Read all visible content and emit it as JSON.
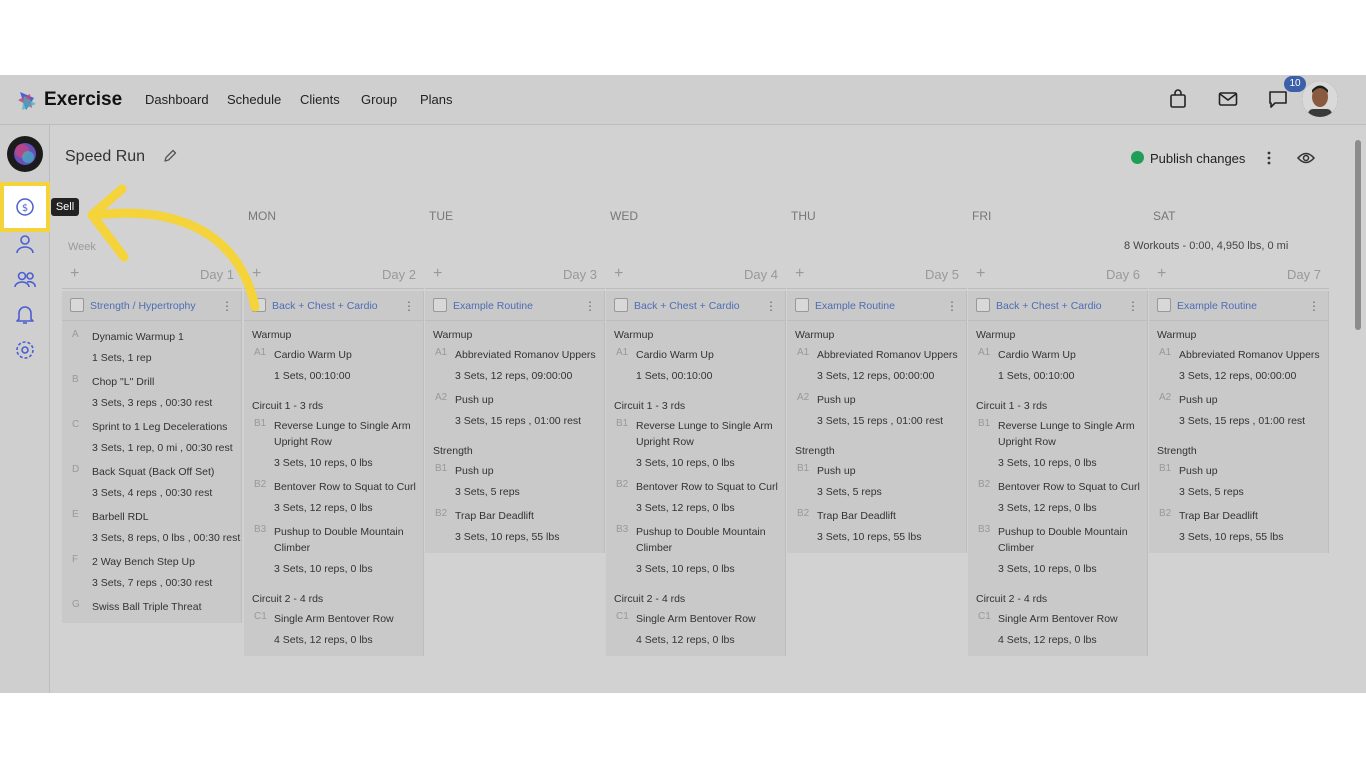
{
  "app": {
    "name": "Exercise"
  },
  "nav": {
    "items": [
      "Dashboard",
      "Schedule",
      "Clients",
      "Group",
      "Plans"
    ]
  },
  "top_icons": {
    "badge_count": "10"
  },
  "rail": {
    "tooltip": "Sell"
  },
  "plan": {
    "title": "Speed Run",
    "publish_label": "Publish changes"
  },
  "days": [
    "MON",
    "TUE",
    "WED",
    "THU",
    "FRI",
    "SAT"
  ],
  "summary": "8 Workouts - 0:00, 4,950 lbs, 0 mi",
  "week_label": "Week",
  "columns": [
    {
      "day": "Day 1",
      "workout": "Strength / Hypertrophy",
      "blocks": [
        {
          "section": "",
          "exercises": [
            {
              "code": "A",
              "name": "Dynamic Warmup 1",
              "detail": "1 Sets, 1 rep"
            },
            {
              "code": "B",
              "name": "Chop \"L\" Drill",
              "detail": "3 Sets, 3 reps , 00:30 rest"
            },
            {
              "code": "C",
              "name": "Sprint to 1 Leg Decelerations",
              "detail": "3 Sets, 1 rep, 0 mi , 00:30 rest"
            },
            {
              "code": "D",
              "name": "Back Squat (Back Off Set)",
              "detail": "3 Sets, 4 reps , 00:30 rest"
            },
            {
              "code": "E",
              "name": "Barbell RDL",
              "detail": "3 Sets, 8 reps, 0 lbs , 00:30 rest"
            },
            {
              "code": "F",
              "name": "2 Way Bench Step Up",
              "detail": "3 Sets, 7 reps , 00:30 rest"
            },
            {
              "code": "G",
              "name": "Swiss Ball Triple Threat",
              "detail": ""
            }
          ]
        }
      ]
    },
    {
      "day": "Day 2",
      "workout": "Back + Chest + Cardio",
      "blocks": [
        {
          "section": "Warmup",
          "exercises": [
            {
              "code": "A1",
              "name": "Cardio Warm Up",
              "detail": "1 Sets, 00:10:00"
            }
          ]
        },
        {
          "section": "Circuit 1 - 3 rds",
          "exercises": [
            {
              "code": "B1",
              "name": "Reverse Lunge to Single Arm Upright Row",
              "detail": "3 Sets, 10 reps, 0 lbs"
            },
            {
              "code": "B2",
              "name": "Bentover Row to Squat to Curl",
              "detail": "3 Sets, 12 reps, 0 lbs"
            },
            {
              "code": "B3",
              "name": "Pushup to Double Mountain Climber",
              "detail": "3 Sets, 10 reps, 0 lbs"
            }
          ]
        },
        {
          "section": "Circuit 2 - 4 rds",
          "exercises": [
            {
              "code": "C1",
              "name": "Single Arm Bentover Row",
              "detail": "4 Sets, 12 reps, 0 lbs"
            }
          ]
        }
      ]
    },
    {
      "day": "Day 3",
      "workout": "Example Routine",
      "blocks": [
        {
          "section": "Warmup",
          "exercises": [
            {
              "code": "A1",
              "name": "Abbreviated Romanov Uppers",
              "detail": "3 Sets, 12 reps, 09:00:00"
            },
            {
              "code": "A2",
              "name": "Push up",
              "detail": "3 Sets, 15 reps , 01:00 rest"
            }
          ]
        },
        {
          "section": "Strength",
          "exercises": [
            {
              "code": "B1",
              "name": "Push up",
              "detail": "3 Sets, 5 reps"
            },
            {
              "code": "B2",
              "name": "Trap Bar Deadlift",
              "detail": "3 Sets, 10 reps, 55 lbs"
            }
          ]
        }
      ]
    },
    {
      "day": "Day 4",
      "workout": "Back + Chest + Cardio",
      "blocks": [
        {
          "section": "Warmup",
          "exercises": [
            {
              "code": "A1",
              "name": "Cardio Warm Up",
              "detail": "1 Sets, 00:10:00"
            }
          ]
        },
        {
          "section": "Circuit 1 - 3 rds",
          "exercises": [
            {
              "code": "B1",
              "name": "Reverse Lunge to Single Arm Upright Row",
              "detail": "3 Sets, 10 reps, 0 lbs"
            },
            {
              "code": "B2",
              "name": "Bentover Row to Squat to Curl",
              "detail": "3 Sets, 12 reps, 0 lbs"
            },
            {
              "code": "B3",
              "name": "Pushup to Double Mountain Climber",
              "detail": "3 Sets, 10 reps, 0 lbs"
            }
          ]
        },
        {
          "section": "Circuit 2 - 4 rds",
          "exercises": [
            {
              "code": "C1",
              "name": "Single Arm Bentover Row",
              "detail": "4 Sets, 12 reps, 0 lbs"
            }
          ]
        }
      ]
    },
    {
      "day": "Day 5",
      "workout": "Example Routine",
      "blocks": [
        {
          "section": "Warmup",
          "exercises": [
            {
              "code": "A1",
              "name": "Abbreviated Romanov Uppers",
              "detail": "3 Sets, 12 reps, 00:00:00"
            },
            {
              "code": "A2",
              "name": "Push up",
              "detail": "3 Sets, 15 reps , 01:00 rest"
            }
          ]
        },
        {
          "section": "Strength",
          "exercises": [
            {
              "code": "B1",
              "name": "Push up",
              "detail": "3 Sets, 5 reps"
            },
            {
              "code": "B2",
              "name": "Trap Bar Deadlift",
              "detail": "3 Sets, 10 reps, 55 lbs"
            }
          ]
        }
      ]
    },
    {
      "day": "Day 6",
      "workout": "Back + Chest + Cardio",
      "blocks": [
        {
          "section": "Warmup",
          "exercises": [
            {
              "code": "A1",
              "name": "Cardio Warm Up",
              "detail": "1 Sets, 00:10:00"
            }
          ]
        },
        {
          "section": "Circuit 1 - 3 rds",
          "exercises": [
            {
              "code": "B1",
              "name": "Reverse Lunge to Single Arm Upright Row",
              "detail": "3 Sets, 10 reps, 0 lbs"
            },
            {
              "code": "B2",
              "name": "Bentover Row to Squat to Curl",
              "detail": "3 Sets, 12 reps, 0 lbs"
            },
            {
              "code": "B3",
              "name": "Pushup to Double Mountain Climber",
              "detail": "3 Sets, 10 reps, 0 lbs"
            }
          ]
        },
        {
          "section": "Circuit 2 - 4 rds",
          "exercises": [
            {
              "code": "C1",
              "name": "Single Arm Bentover Row",
              "detail": "4 Sets, 12 reps, 0 lbs"
            }
          ]
        }
      ]
    },
    {
      "day": "Day 7",
      "workout": "Example Routine",
      "blocks": [
        {
          "section": "Warmup",
          "exercises": [
            {
              "code": "A1",
              "name": "Abbreviated Romanov Uppers",
              "detail": "3 Sets, 12 reps, 00:00:00"
            },
            {
              "code": "A2",
              "name": "Push up",
              "detail": "3 Sets, 15 reps , 01:00 rest"
            }
          ]
        },
        {
          "section": "Strength",
          "exercises": [
            {
              "code": "B1",
              "name": "Push up",
              "detail": "3 Sets, 5 reps"
            },
            {
              "code": "B2",
              "name": "Trap Bar Deadlift",
              "detail": "3 Sets, 10 reps, 55 lbs"
            }
          ]
        }
      ]
    }
  ],
  "colors": {
    "highlight": "#f5d33a",
    "publish": "#1e9e57",
    "link": "#4d6db3",
    "badge": "#3b5fa8"
  }
}
